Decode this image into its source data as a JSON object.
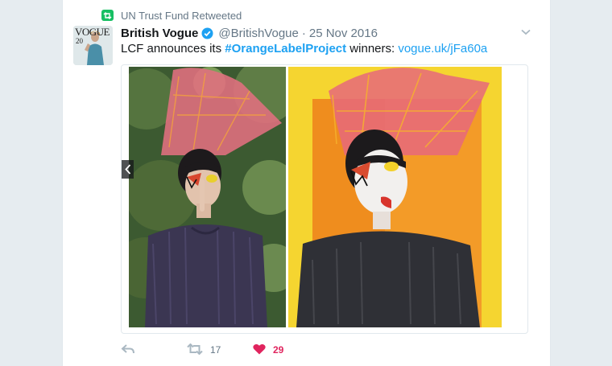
{
  "retweet_context": {
    "text": "UN Trust Fund Retweeted",
    "icon": "retweet-icon",
    "color": "#17bf63"
  },
  "author": {
    "display_name": "British Vogue",
    "verified_icon": "verified-badge-icon",
    "screen_name": "@BritishVogue",
    "separator": "·",
    "timestamp": "25 Nov 2016",
    "avatar_masthead": "VOGUE",
    "avatar_issue": "20"
  },
  "tweet": {
    "text_before": "LCF announces its ",
    "hashtag": "#OrangeLabelProject",
    "text_middle": " winners: ",
    "link": "vogue.uk/jFa60a"
  },
  "media": {
    "photos": [
      "left-photo-green-backdrop",
      "right-photo-orange-backdrop"
    ],
    "prev_icon": "chevron-left-icon"
  },
  "actions": {
    "reply_icon": "reply-icon",
    "retweet_icon": "retweet-icon",
    "retweet_count": "17",
    "like_icon": "heart-icon",
    "like_count": "29",
    "like_color": "#e0245e"
  },
  "colors": {
    "link": "#1da1f2",
    "secondary_text": "#657786",
    "background": "#e6ecf0"
  }
}
